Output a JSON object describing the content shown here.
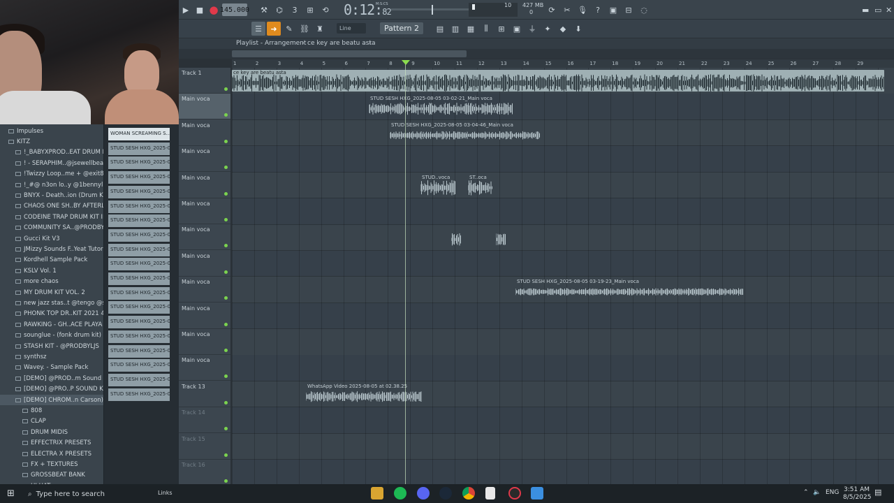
{
  "toolbar": {
    "bpm": "145.000",
    "time_main": "0:12:",
    "time_frac": "82",
    "time_unit": "M:S:CS",
    "cpu": "10",
    "memory": "427 MB",
    "poly": "0",
    "snap": "Line",
    "pattern": "Pattern 2"
  },
  "playlist": {
    "title": "Playlist - Arrangement",
    "sep": "›",
    "arrangement": "ce key are beatu asta",
    "ruler": [
      "1",
      "2",
      "3",
      "4",
      "5",
      "6",
      "7",
      "8",
      "9",
      "10",
      "11",
      "12",
      "13",
      "14",
      "15",
      "16",
      "17",
      "18",
      "19",
      "20",
      "21",
      "22",
      "23",
      "24",
      "25",
      "26",
      "27",
      "28",
      "29"
    ],
    "tracks": [
      {
        "label": "Track 1",
        "dim": false
      },
      {
        "label": "Main voca",
        "dim": false,
        "group": true
      },
      {
        "label": "Main voca",
        "dim": false
      },
      {
        "label": "Main voca",
        "dim": false
      },
      {
        "label": "Main voca",
        "dim": false
      },
      {
        "label": "Main voca",
        "dim": false
      },
      {
        "label": "Main voca",
        "dim": false
      },
      {
        "label": "Main voca",
        "dim": false
      },
      {
        "label": "Main voca",
        "dim": false
      },
      {
        "label": "Main voca",
        "dim": false
      },
      {
        "label": "Main voca",
        "dim": false
      },
      {
        "label": "Main voca",
        "dim": false
      },
      {
        "label": "Track 13",
        "dim": false
      },
      {
        "label": "Track 14",
        "dim": true
      },
      {
        "label": "Track 15",
        "dim": true
      },
      {
        "label": "Track 16",
        "dim": true
      }
    ],
    "clips": {
      "c1": "ce key are beatu asta",
      "c2": "STUD SESH HXG_2025-08-05 03-02-21_Main voca",
      "c3": "STUD SESH HXG_2025-08-05 03-04-46_Main voca",
      "c4": "STUD..voca",
      "c5": "ST..oca",
      "c8": "STUD SESH HXG_2025-08-05 03-19-23_Main voca",
      "c9": "WhatsApp Video 2025-08-05 at 02.38.25"
    }
  },
  "browser": {
    "items": [
      {
        "label": "Impulses",
        "indent": 0
      },
      {
        "label": "KITZ",
        "indent": 0
      },
      {
        "label": "!_BABYXPROD..EAT DRUM KIT",
        "indent": 1
      },
      {
        "label": "! - SERAPHIM..@jsewellbeats",
        "indent": 1
      },
      {
        "label": "!Twizzy Loop..me + @exit808_",
        "indent": 1
      },
      {
        "label": "!_#@ n3on lo..y @1bennyluv]",
        "indent": 1
      },
      {
        "label": "BNYX - Death..ion (Drum Kit)",
        "indent": 1
      },
      {
        "label": "CHAOS ONE SH..BY AFTERLIFE",
        "indent": 1
      },
      {
        "label": "CODEINE TRAP DRUM KIT II",
        "indent": 1
      },
      {
        "label": "COMMUNITY SA..@PRODBYLJS",
        "indent": 1
      },
      {
        "label": "Gucci Kit V3",
        "indent": 1
      },
      {
        "label": "JMizzy Sounds F..Yeat Tutorial",
        "indent": 1
      },
      {
        "label": "Kordhell Sample Pack",
        "indent": 1
      },
      {
        "label": "KSLV Vol. 1",
        "indent": 1
      },
      {
        "label": "more chaos",
        "indent": 1
      },
      {
        "label": "MY DRUM KIT VOL. 2",
        "indent": 1
      },
      {
        "label": "new jazz stas..t @tengo @scrn",
        "indent": 1
      },
      {
        "label": "PHONK TOP DR..KIT 2021 4GB",
        "indent": 1
      },
      {
        "label": "RAWKING - GH..ACE PLAYA KIT",
        "indent": 1
      },
      {
        "label": "sounglue - (fonk drum kit)",
        "indent": 1
      },
      {
        "label": "STASH KIT - @PRODBYLJS",
        "indent": 1
      },
      {
        "label": "synthsz",
        "indent": 1
      },
      {
        "label": "Wavey. - Sample Pack",
        "indent": 1
      },
      {
        "label": "[DEMO] @PROD..m Sound Kit",
        "indent": 1
      },
      {
        "label": "[DEMO] @PRO..P SOUND KIT",
        "indent": 1
      },
      {
        "label": "[DEMO] CHROM..n Carson)",
        "indent": 1,
        "selected": true
      },
      {
        "label": "808",
        "indent": 2
      },
      {
        "label": "CLAP",
        "indent": 2
      },
      {
        "label": "DRUM MIDIS",
        "indent": 2
      },
      {
        "label": "EFFECTRIX PRESETS",
        "indent": 2
      },
      {
        "label": "ELECTRA X PRESETS",
        "indent": 2
      },
      {
        "label": "FX + TEXTURES",
        "indent": 2
      },
      {
        "label": "GROSSBEAT BANK",
        "indent": 2
      },
      {
        "label": "HI HAT",
        "indent": 2
      }
    ]
  },
  "picker": {
    "items": [
      "WOMAN SCREAMING S...",
      "STUD SESH HXG_2025-08...",
      "STUD SESH HXG_2025-08...",
      "STUD SESH HXG_2025-08...",
      "STUD SESH HXG_2025-08...",
      "STUD SESH HXG_2025-08...",
      "STUD SESH HXG_2025-08...",
      "STUD SESH HXG_2025-08...",
      "STUD SESH HXG_2025-08...",
      "STUD SESH HXG_2025-08...",
      "STUD SESH HXG_2025-08...",
      "STUD SESH HXG_2025-08...",
      "STUD SESH HXG_2025-08...",
      "STUD SESH HXG_2025-08...",
      "STUD SESH HXG_2025-08...",
      "STUD SESH HXG_2025-08...",
      "STUD SESH HXG_2025-08...",
      "STUD SESH HXG_2025-08...",
      "STUD SESH HXG_2025-08..."
    ]
  },
  "taskbar": {
    "search": "Type here to search",
    "links": "Links",
    "lang": "ENG",
    "time": "3:51 AM",
    "date": "8/5/2025"
  },
  "colors": {
    "accent_green": "#8bdc4f",
    "toolbar_bg": "#3a444c",
    "grid_bg": "#3a444c",
    "clip_bright": "#9fb0b4",
    "record_red": "#e0394a"
  }
}
